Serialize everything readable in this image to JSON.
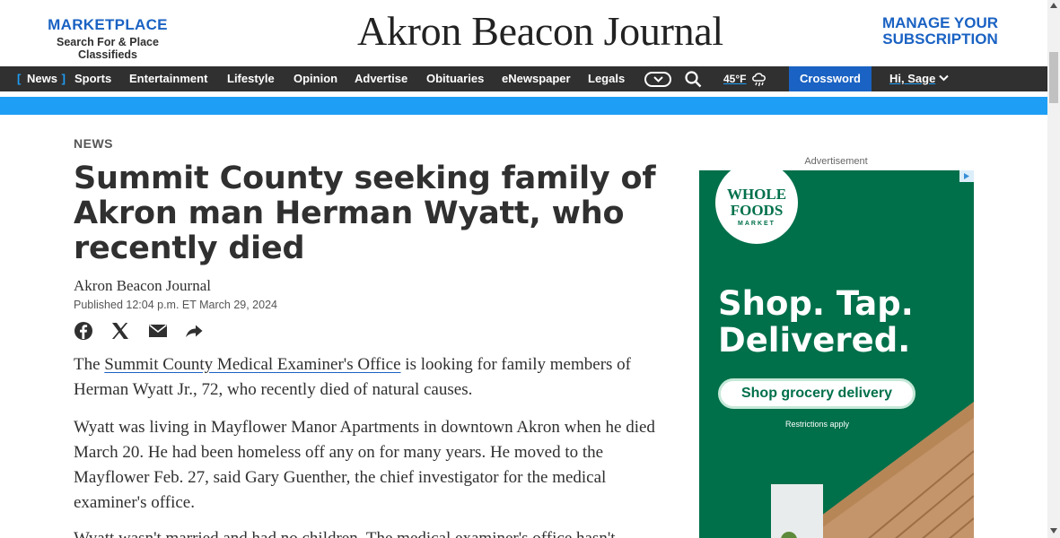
{
  "header": {
    "marketplace_title": "MARKETPLACE",
    "marketplace_subtitle": "Search For & Place Classifieds",
    "logo_text": "Akron Beacon Journal",
    "manage_line1": "MANAGE YOUR",
    "manage_line2": "SUBSCRIPTION"
  },
  "nav": {
    "items": [
      "News",
      "Sports",
      "Entertainment",
      "Lifestyle",
      "Opinion",
      "Advertise",
      "Obituaries",
      "eNewspaper",
      "Legals"
    ],
    "active": "News",
    "weather": "45°F",
    "crossword": "Crossword",
    "user": "Hi, Sage"
  },
  "article": {
    "section": "NEWS",
    "headline": "Summit County seeking family of Akron man Herman Wyatt, who recently died",
    "byline": "Akron Beacon Journal",
    "published": "Published 12:04 p.m. ET March 29, 2024",
    "para1_pre": "The ",
    "para1_link": "Summit County Medical Examiner's Office",
    "para1_post": " is looking for family members of Herman Wyatt Jr., 72, who recently died of natural causes.",
    "para2": "Wyatt was living in Mayflower Manor Apartments in downtown Akron when he died March 20. He had been homeless off any on for many years. He moved to the Mayflower Feb. 27, said Gary Guenther, the chief investigator for the medical examiner's office.",
    "para3": "Wyatt wasn't married and had no children. The medical examiner's office hasn't"
  },
  "ad": {
    "label": "Advertisement",
    "brand_line1": "WHOLE",
    "brand_line2": "FOODS",
    "brand_line3": "MARKET",
    "headline": "Shop. Tap. Delivered.",
    "cta": "Shop grocery delivery",
    "fine_print": "Restrictions apply"
  },
  "colors": {
    "brand_blue": "#1a62c3",
    "accent_blue": "#1e9ef5",
    "nav_bg": "#303030",
    "ad_green": "#00704a"
  }
}
